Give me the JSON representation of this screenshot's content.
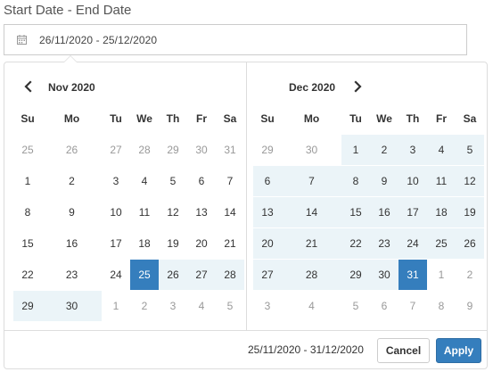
{
  "field": {
    "label": "Start Date - End Date",
    "value": "26/11/2020 - 25/12/2020",
    "icon": "calendar-icon"
  },
  "colors": {
    "accent": "#357ebd",
    "in_range": "#ebf4f8",
    "off_day": "#999999",
    "border": "#dddddd"
  },
  "calendars": [
    {
      "month": "Nov 2020",
      "nav": "prev",
      "weekdays": [
        "Su",
        "Mo",
        "Tu",
        "We",
        "Th",
        "Fr",
        "Sa"
      ],
      "weeks": [
        [
          "25",
          "26",
          "27",
          "28",
          "29",
          "30",
          "31"
        ],
        [
          "1",
          "2",
          "3",
          "4",
          "5",
          "6",
          "7"
        ],
        [
          "8",
          "9",
          "10",
          "11",
          "12",
          "13",
          "14"
        ],
        [
          "15",
          "16",
          "17",
          "18",
          "19",
          "20",
          "21"
        ],
        [
          "22",
          "23",
          "24",
          "25",
          "26",
          "27",
          "28"
        ],
        [
          "29",
          "30",
          "1",
          "2",
          "3",
          "4",
          "5"
        ]
      ],
      "state": [
        [
          "off",
          "off",
          "off",
          "off",
          "off",
          "off",
          "off"
        ],
        [
          "",
          "",
          "",
          "",
          "",
          "",
          ""
        ],
        [
          "",
          "",
          "",
          "",
          "",
          "",
          ""
        ],
        [
          "",
          "",
          "",
          "",
          "",
          "",
          ""
        ],
        [
          "",
          "",
          "",
          "active",
          "in-range",
          "in-range",
          "in-range"
        ],
        [
          "in-range",
          "in-range",
          "off",
          "off",
          "off",
          "off",
          "off"
        ]
      ]
    },
    {
      "month": "Dec 2020",
      "nav": "next",
      "weekdays": [
        "Su",
        "Mo",
        "Tu",
        "We",
        "Th",
        "Fr",
        "Sa"
      ],
      "weeks": [
        [
          "29",
          "30",
          "1",
          "2",
          "3",
          "4",
          "5"
        ],
        [
          "6",
          "7",
          "8",
          "9",
          "10",
          "11",
          "12"
        ],
        [
          "13",
          "14",
          "15",
          "16",
          "17",
          "18",
          "19"
        ],
        [
          "20",
          "21",
          "22",
          "23",
          "24",
          "25",
          "26"
        ],
        [
          "27",
          "28",
          "29",
          "30",
          "31",
          "1",
          "2"
        ],
        [
          "3",
          "4",
          "5",
          "6",
          "7",
          "8",
          "9"
        ]
      ],
      "state": [
        [
          "off",
          "off",
          "in-range",
          "in-range",
          "in-range",
          "in-range",
          "in-range"
        ],
        [
          "in-range",
          "in-range",
          "in-range",
          "in-range",
          "in-range",
          "in-range",
          "in-range"
        ],
        [
          "in-range",
          "in-range",
          "in-range",
          "in-range",
          "in-range",
          "in-range",
          "in-range"
        ],
        [
          "in-range",
          "in-range",
          "in-range",
          "in-range",
          "in-range",
          "in-range",
          "in-range"
        ],
        [
          "in-range",
          "in-range",
          "in-range",
          "in-range",
          "active",
          "off",
          "off"
        ],
        [
          "off",
          "off",
          "off",
          "off",
          "off",
          "off",
          "off"
        ]
      ]
    }
  ],
  "footer": {
    "selected_range": "25/11/2020 - 31/12/2020",
    "cancel_label": "Cancel",
    "apply_label": "Apply"
  }
}
